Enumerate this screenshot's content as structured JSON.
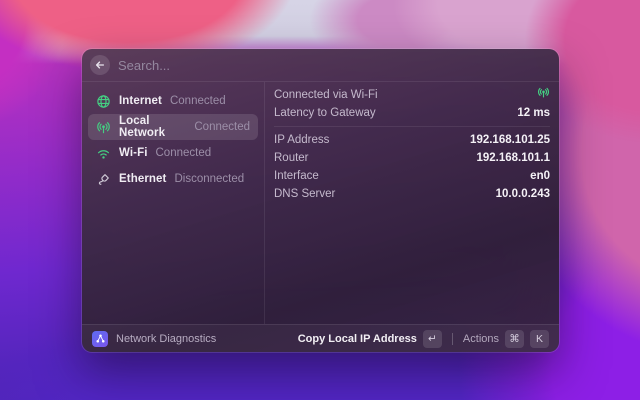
{
  "search": {
    "placeholder": "Search..."
  },
  "sidebar": {
    "items": [
      {
        "icon": "globe-icon",
        "label": "Internet",
        "status": "Connected",
        "selected": false
      },
      {
        "icon": "antenna-icon",
        "label": "Local Network",
        "status": "Connected",
        "selected": true
      },
      {
        "icon": "wifi-icon",
        "label": "Wi-Fi",
        "status": "Connected",
        "selected": false
      },
      {
        "icon": "ethernet-icon",
        "label": "Ethernet",
        "status": "Disconnected",
        "selected": false
      }
    ]
  },
  "details": {
    "sections": [
      {
        "rows": [
          {
            "label": "Connected via Wi-Fi",
            "value": "",
            "value_icon": "antenna-icon"
          },
          {
            "label": "Latency to Gateway",
            "value": "12 ms"
          }
        ]
      },
      {
        "rows": [
          {
            "label": "IP Address",
            "value": "192.168.101.25"
          },
          {
            "label": "Router",
            "value": "192.168.101.1"
          },
          {
            "label": "Interface",
            "value": "en0"
          },
          {
            "label": "DNS Server",
            "value": "10.0.0.243"
          }
        ]
      }
    ]
  },
  "footer": {
    "app_name": "Network Diagnostics",
    "primary_action": "Copy Local IP Address",
    "primary_key": "↵",
    "actions_label": "Actions",
    "cmd_key": "⌘",
    "k_key": "K"
  },
  "colors": {
    "accent_green": "#44cf82",
    "icon_muted": "#cfc9d6",
    "app_icon_blue": "#5e6cf0"
  }
}
